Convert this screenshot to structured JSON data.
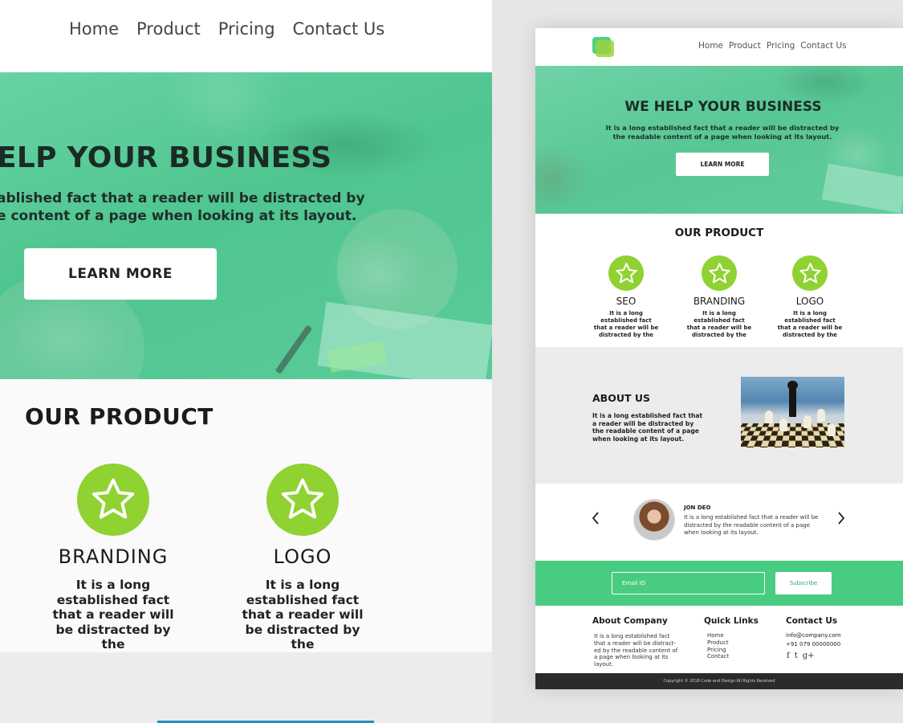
{
  "nav": {
    "items": [
      "Home",
      "Product",
      "Pricing",
      "Contact Us"
    ]
  },
  "hero": {
    "title": "WE HELP YOUR BUSINESS",
    "subtitle_line1": "It is a long established fact that a reader will be distracted by",
    "subtitle_line2": "the readable content of a page when looking at its layout.",
    "button_label": "LEARN MORE"
  },
  "zoom": {
    "hero_title_visible": "ELP YOUR BUSINESS",
    "hero_sub_line1_visible": "ablished fact that a reader will be distracted by",
    "hero_sub_line2_visible": "e content of a page when looking at its layout."
  },
  "product": {
    "title": "OUR PRODUCT",
    "items": [
      {
        "title": "SEO",
        "desc": "It is a long established fact that a reader will be distracted by the",
        "icon": "star-icon"
      },
      {
        "title": "BRANDING",
        "desc": "It is a long established fact that a reader will be distracted by the",
        "icon": "star-icon"
      },
      {
        "title": "LOGO",
        "desc": "It is a long established fact that a reader will be distracted by the",
        "icon": "star-icon"
      }
    ]
  },
  "about": {
    "title": "ABOUT US",
    "text": "It is a long established fact that a reader will be distracted by the readable content of a page when looking at its layout."
  },
  "testimonial": {
    "name": "JON DEO",
    "quote": "It is a long established fact that a reader will be distracted by the readable content of a page when looking at its layout."
  },
  "newsletter": {
    "placeholder": "Email ID",
    "button_label": "Subscribe"
  },
  "footer": {
    "about_title": "About Company",
    "about_text": "It is a long established fact that a reader will be distract-ed by the readable content of a page when looking at its layout.",
    "links_title": "Quick Links",
    "links": [
      "Home",
      "Product",
      "Pricing",
      "Contact"
    ],
    "contact_title": "Contact Us",
    "email": "info@company.com",
    "phone": "+91 079 00000000",
    "social": [
      "f",
      "t",
      "g+"
    ]
  },
  "copyright": "Copyright © 2018 Code and Design All Rights Received",
  "colors": {
    "accent_green": "#48cc82",
    "icon_green": "#8fd231",
    "hero_overlay": "#58c794",
    "footer_bar": "#2b2b2b"
  }
}
